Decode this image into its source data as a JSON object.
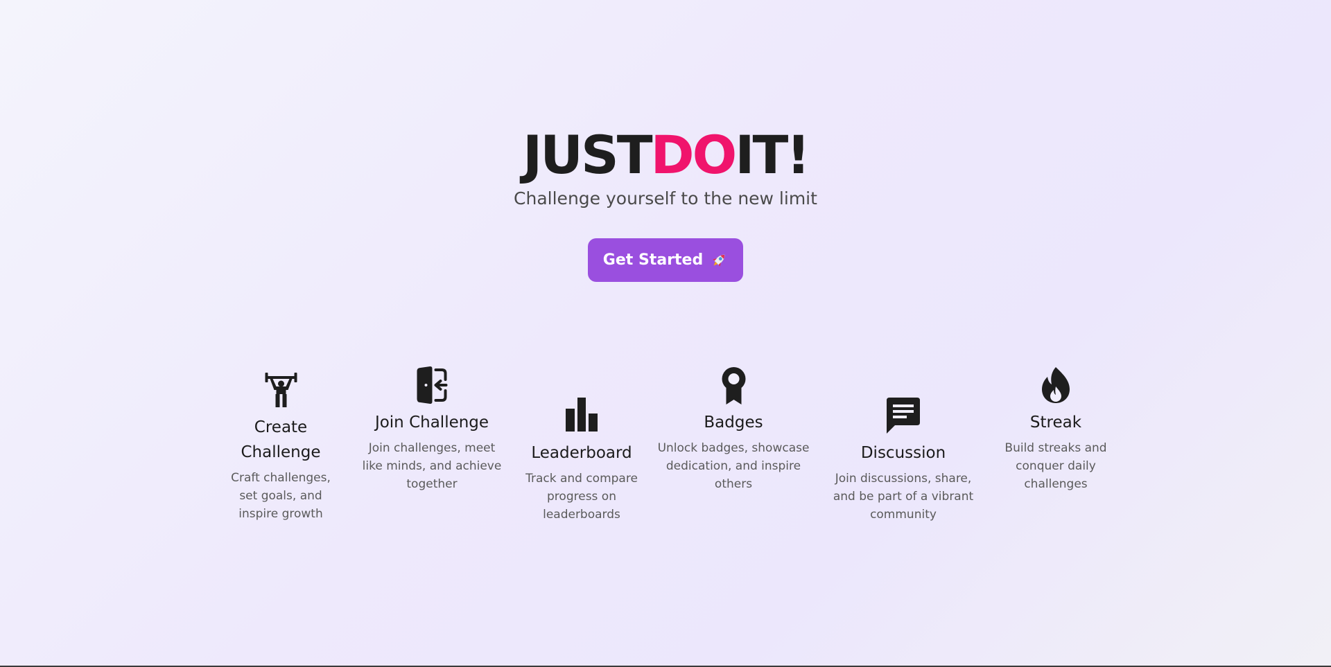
{
  "logo": {
    "part1": "JUST",
    "part2": "DO",
    "part3": "IT!"
  },
  "tagline": "Challenge yourself to the new limit",
  "cta": {
    "label": "Get Started",
    "icon": "rocket-icon"
  },
  "colors": {
    "accent": "#f0146c",
    "button": "#9a4fdf",
    "text_dark": "#1e1e1e"
  },
  "features": [
    {
      "icon": "weightlifter-icon",
      "title": "Create Challenge",
      "description": "Craft challenges, set goals, and inspire growth"
    },
    {
      "icon": "door-enter-icon",
      "title": "Join Challenge",
      "description": "Join challenges, meet like minds, and achieve together"
    },
    {
      "icon": "bar-chart-icon",
      "title": "Leaderboard",
      "description": "Track and compare progress on leaderboards"
    },
    {
      "icon": "award-ribbon-icon",
      "title": "Badges",
      "description": "Unlock badges, showcase dedication, and inspire others"
    },
    {
      "icon": "chat-bubble-icon",
      "title": "Discussion",
      "description": "Join discussions, share, and be part of a vibrant community"
    },
    {
      "icon": "flame-icon",
      "title": "Streak",
      "description": "Build streaks and conquer daily challenges"
    }
  ]
}
